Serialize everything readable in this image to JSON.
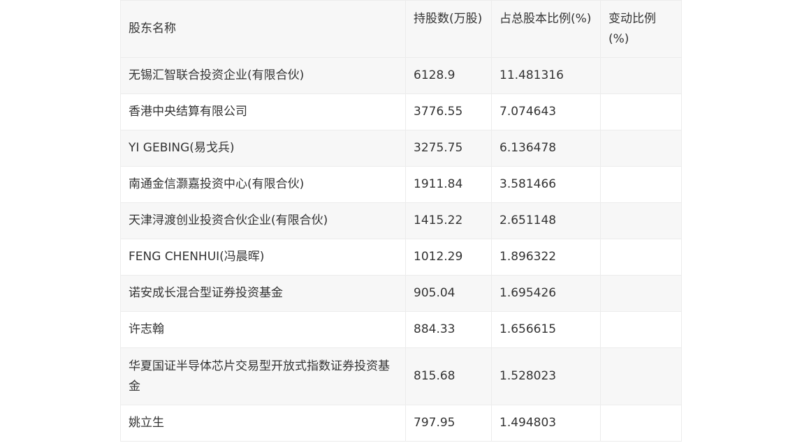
{
  "table": {
    "headers": [
      "股东名称",
      "持股数(万股)",
      "占总股本比例(%)",
      "变动比例(%)"
    ],
    "rows": [
      {
        "name": "无锡汇智联合投资企业(有限合伙)",
        "shares": "6128.9",
        "ratio": "11.481316",
        "change": ""
      },
      {
        "name": "香港中央结算有限公司",
        "shares": "3776.55",
        "ratio": "7.074643",
        "change": ""
      },
      {
        "name": "YI GEBING(易戈兵)",
        "shares": "3275.75",
        "ratio": "6.136478",
        "change": ""
      },
      {
        "name": "南通金信灏嘉投资中心(有限合伙)",
        "shares": "1911.84",
        "ratio": "3.581466",
        "change": ""
      },
      {
        "name": "天津浔渡创业投资合伙企业(有限合伙)",
        "shares": "1415.22",
        "ratio": "2.651148",
        "change": ""
      },
      {
        "name": "FENG CHENHUI(冯晨晖)",
        "shares": "1012.29",
        "ratio": "1.896322",
        "change": ""
      },
      {
        "name": "诺安成长混合型证券投资基金",
        "shares": "905.04",
        "ratio": "1.695426",
        "change": ""
      },
      {
        "name": "许志翰",
        "shares": "884.33",
        "ratio": "1.656615",
        "change": ""
      },
      {
        "name": "华夏国证半导体芯片交易型开放式指数证券投资基金",
        "shares": "815.68",
        "ratio": "1.528023",
        "change": ""
      },
      {
        "name": "姚立生",
        "shares": "797.95",
        "ratio": "1.494803",
        "change": ""
      }
    ]
  }
}
